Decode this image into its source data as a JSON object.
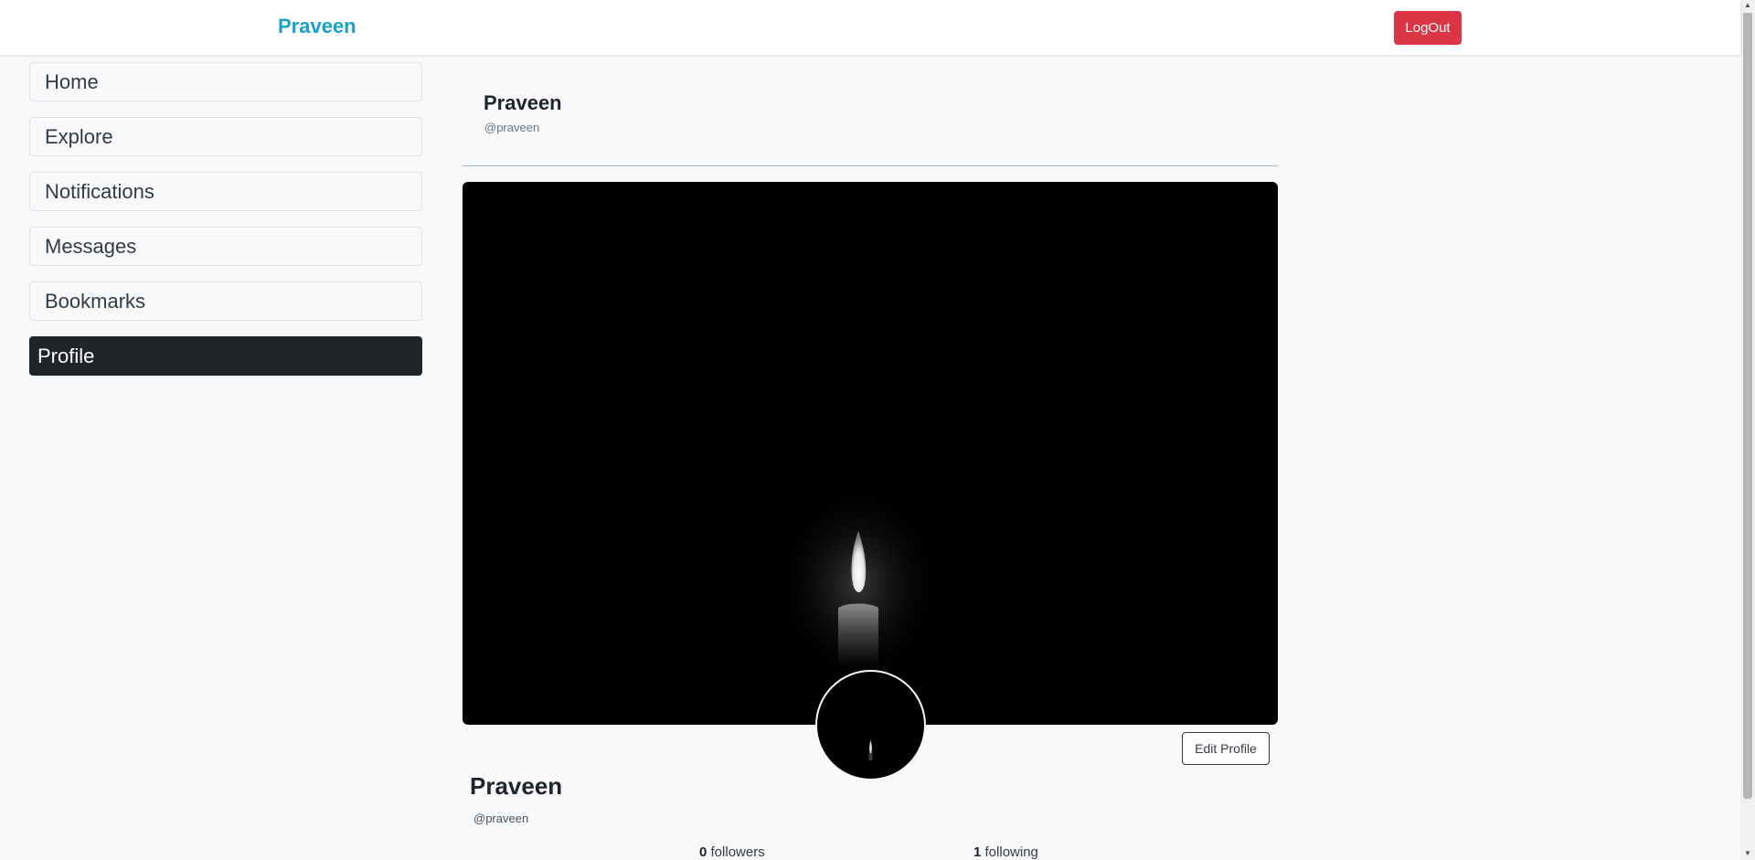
{
  "navbar": {
    "brand": "Praveen",
    "logout_label": "LogOut"
  },
  "sidebar": {
    "items": [
      {
        "label": "Home"
      },
      {
        "label": "Explore"
      },
      {
        "label": "Notifications"
      },
      {
        "label": "Messages"
      },
      {
        "label": "Bookmarks"
      },
      {
        "label": "Profile",
        "active": true
      }
    ]
  },
  "header": {
    "name": "Praveen",
    "handle": "@praveen"
  },
  "profile": {
    "name": "Praveen",
    "handle": "@praveen",
    "edit_label": "Edit Profile",
    "followers_count": "0",
    "followers_label": "followers",
    "following_count": "1",
    "following_label": "following"
  },
  "colors": {
    "brand": "#17a2c8",
    "logout": "#dc3545",
    "active_nav": "#212529",
    "background": "#f8f9fa"
  }
}
